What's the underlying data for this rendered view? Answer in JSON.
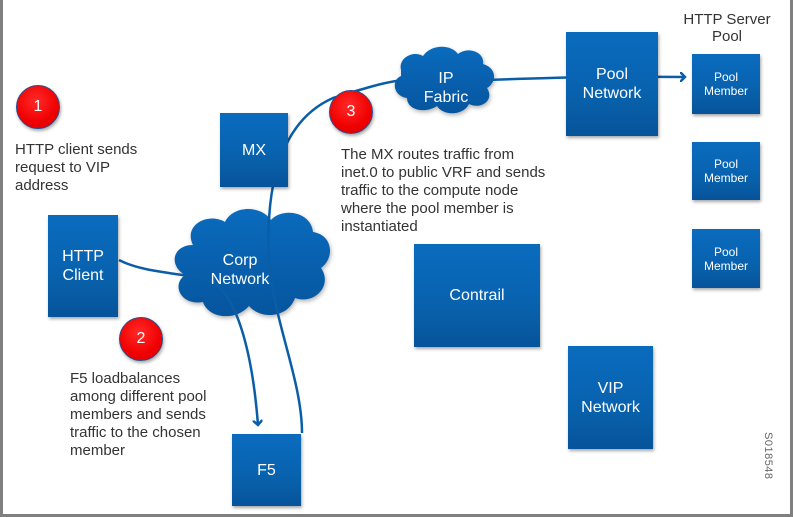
{
  "diagram": {
    "heading": "HTTP Server\nPool",
    "figure_id": "S018548",
    "colors": {
      "node_blue": "#0966b6",
      "badge_red": "#f00000",
      "line_blue": "#0a5ea8",
      "text_gray": "#333333",
      "frame_gray": "#808080"
    },
    "nodes": {
      "http_client": "HTTP\nClient",
      "mx": "MX",
      "f5": "F5",
      "pool_network": "Pool\nNetwork",
      "contrail": "Contrail",
      "vip_network": "VIP\nNetwork",
      "pool_members": [
        "Pool\nMember",
        "Pool\nMember",
        "Pool\nMember"
      ]
    },
    "clouds": {
      "corp_network": "Corp\nNetwork",
      "ip_fabric": "IP\nFabric"
    },
    "steps": [
      {
        "number": "1",
        "text": "HTTP client sends\nrequest to VIP\naddress"
      },
      {
        "number": "2",
        "text": "F5 loadbalances\namong different pool\nmembers and sends\ntraffic to the chosen\nmember"
      },
      {
        "number": "3",
        "text": "The MX routes traffic from\ninet.0 to public VRF and sends\ntraffic to the compute node\nwhere the pool member is\ninstantiated"
      }
    ]
  }
}
